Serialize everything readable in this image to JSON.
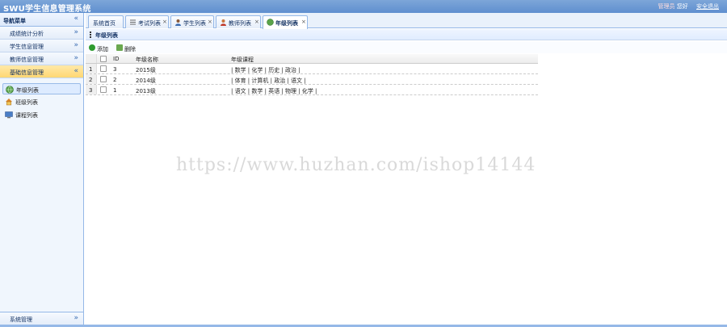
{
  "header": {
    "title": "SWU学生信息管理系统",
    "admin_label": "管理员",
    "welcome_label": "您好",
    "logout_label": "安全退出"
  },
  "sidebar": {
    "title": "导航菜单",
    "groups": [
      {
        "label": "成绩统计分析"
      },
      {
        "label": "学生信息管理"
      },
      {
        "label": "教师信息管理"
      },
      {
        "label": "基础信息管理"
      }
    ],
    "leaves": [
      {
        "label": "年级列表",
        "icon": "globe-icon"
      },
      {
        "label": "班级列表",
        "icon": "house-icon"
      },
      {
        "label": "课程列表",
        "icon": "screen-icon"
      }
    ],
    "footer_label": "系统管理"
  },
  "tabs": [
    {
      "label": "系统首页"
    },
    {
      "label": "考试列表",
      "close": "×"
    },
    {
      "label": "学生列表",
      "close": "×"
    },
    {
      "label": "教师列表",
      "close": "×"
    },
    {
      "label": "年级列表",
      "close": "×"
    }
  ],
  "panel": {
    "title": "年级列表"
  },
  "toolbar": {
    "add_label": "添加",
    "delete_label": "删除"
  },
  "grid": {
    "headers": {
      "id": "ID",
      "name": "年级名称",
      "courses": "年级课程"
    },
    "rows": [
      {
        "num": "1",
        "id": "3",
        "name": "2015级",
        "courses": "| 数学 | 化学 | 历史 | 政治 |"
      },
      {
        "num": "2",
        "id": "2",
        "name": "2014级",
        "courses": "| 体育 | 计算机 | 政治 | 语文 |"
      },
      {
        "num": "3",
        "id": "1",
        "name": "2013级",
        "courses": "| 语文 | 数学 | 英语 | 物理 | 化学 |"
      }
    ]
  },
  "watermark": "https://www.huzhan.com/ishop14144",
  "colors": {
    "header_bg": "#5f8fcf",
    "border": "#95b8e7",
    "active_group": "#ffd773",
    "add_icon": "#2e9b2e",
    "delete_icon": "#4c9a3c"
  }
}
